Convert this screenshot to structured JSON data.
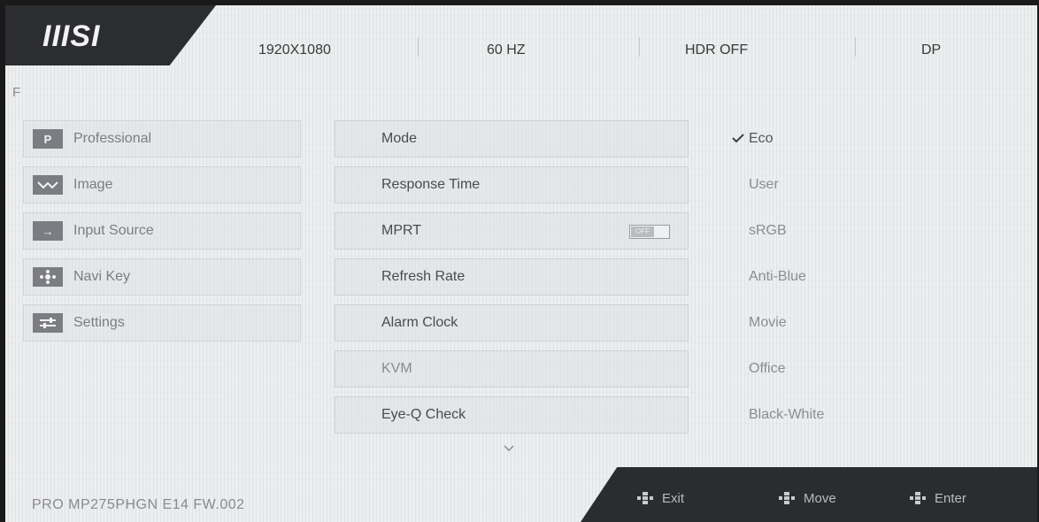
{
  "header": {
    "brand": "IIISI",
    "resolution": "1920X1080",
    "refresh": "60 HZ",
    "hdr": "HDR OFF",
    "input": "DP"
  },
  "section_letter": "F",
  "left_menu": [
    {
      "label": "Professional",
      "icon": "professional-icon",
      "glyph": "P"
    },
    {
      "label": "Image",
      "icon": "image-icon",
      "glyph": ""
    },
    {
      "label": "Input Source",
      "icon": "input-arrow-icon",
      "glyph": "→"
    },
    {
      "label": "Navi Key",
      "icon": "navi-key-icon",
      "glyph": ""
    },
    {
      "label": "Settings",
      "icon": "settings-sliders-icon",
      "glyph": ""
    }
  ],
  "middle_menu": [
    {
      "label": "Mode"
    },
    {
      "label": "Response Time"
    },
    {
      "label": "MPRT",
      "toggle": "OFF"
    },
    {
      "label": "Refresh Rate"
    },
    {
      "label": "Alarm Clock"
    },
    {
      "label": "KVM"
    },
    {
      "label": "Eye-Q Check"
    }
  ],
  "options": [
    "Eco",
    "User",
    "sRGB",
    "Anti-Blue",
    "Movie",
    "Office",
    "Black-White"
  ],
  "selected_option": "Eco",
  "footer": {
    "model": "PRO MP275PHGN E14  FW.002",
    "exit": "Exit",
    "move": "Move",
    "enter": "Enter"
  },
  "colors": {
    "panel": "#eceeef",
    "dark_slab": "#2b2d30",
    "text_dim": "#8c8d92"
  }
}
